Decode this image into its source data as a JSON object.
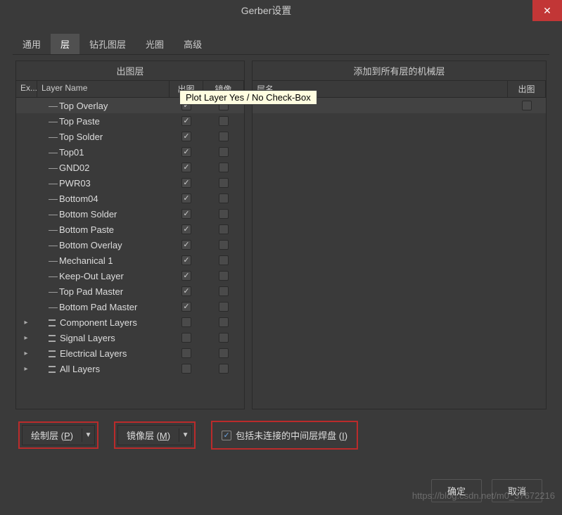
{
  "title": "Gerber设置",
  "tabs": [
    "通用",
    "层",
    "钻孔图层",
    "光圈",
    "高级"
  ],
  "active_tab": 1,
  "left_panel": {
    "title": "出图层",
    "headers": {
      "ex": "Ex...",
      "name": "Layer Name",
      "plot": "出图",
      "mirror": "镜像"
    },
    "rows": [
      {
        "name": "Top Overlay",
        "plot": true,
        "mirror": false,
        "type": "layer"
      },
      {
        "name": "Top Paste",
        "plot": true,
        "mirror": false,
        "type": "layer"
      },
      {
        "name": "Top Solder",
        "plot": true,
        "mirror": false,
        "type": "layer"
      },
      {
        "name": "Top01",
        "plot": true,
        "mirror": false,
        "type": "layer"
      },
      {
        "name": "GND02",
        "plot": true,
        "mirror": false,
        "type": "layer"
      },
      {
        "name": "PWR03",
        "plot": true,
        "mirror": false,
        "type": "layer"
      },
      {
        "name": "Bottom04",
        "plot": true,
        "mirror": false,
        "type": "layer"
      },
      {
        "name": "Bottom Solder",
        "plot": true,
        "mirror": false,
        "type": "layer"
      },
      {
        "name": "Bottom Paste",
        "plot": true,
        "mirror": false,
        "type": "layer"
      },
      {
        "name": "Bottom Overlay",
        "plot": true,
        "mirror": false,
        "type": "layer"
      },
      {
        "name": "Mechanical 1",
        "plot": true,
        "mirror": false,
        "type": "layer"
      },
      {
        "name": "Keep-Out Layer",
        "plot": true,
        "mirror": false,
        "type": "layer"
      },
      {
        "name": "Top Pad Master",
        "plot": true,
        "mirror": false,
        "type": "layer"
      },
      {
        "name": "Bottom Pad Master",
        "plot": true,
        "mirror": false,
        "type": "layer"
      },
      {
        "name": "Component Layers",
        "plot": false,
        "mirror": false,
        "type": "group"
      },
      {
        "name": "Signal Layers",
        "plot": false,
        "mirror": false,
        "type": "group"
      },
      {
        "name": "Electrical Layers",
        "plot": false,
        "mirror": false,
        "type": "group"
      },
      {
        "name": "All Layers",
        "plot": false,
        "mirror": false,
        "type": "group"
      }
    ]
  },
  "right_panel": {
    "title": "添加到所有层的机械层",
    "headers": {
      "name": "层名",
      "plot": "出图"
    }
  },
  "tooltip": "Plot Layer Yes / No Check-Box",
  "dropdowns": {
    "plot_layers": "绘制层 (P)",
    "mirror_layers": "镜像层 (M)"
  },
  "include_checkbox": "包括未连接的中间层焊盘 (I)",
  "buttons": {
    "ok": "确定",
    "cancel": "取消"
  },
  "watermark": "https://blog.csdn.net/m0_37672216"
}
